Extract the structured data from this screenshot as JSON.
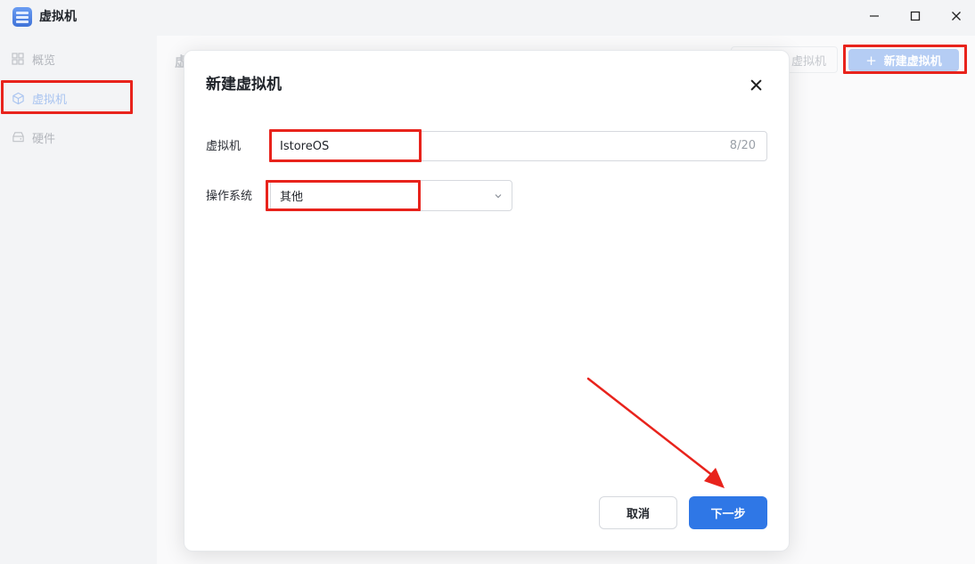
{
  "window": {
    "title": "虚拟机",
    "icons": {
      "app": "server-stack-icon",
      "minimize": "minimize-icon",
      "maximize": "maximize-icon",
      "close": "close-icon"
    }
  },
  "sidebar": {
    "items": [
      {
        "label": "概览",
        "icon": "grid-icon"
      },
      {
        "label": "虚拟机",
        "icon": "cube-icon",
        "active": true
      },
      {
        "label": "硬件",
        "icon": "drive-icon"
      }
    ]
  },
  "main": {
    "page_title": "虚",
    "secondary_button": "虚拟机",
    "new_vm_button": "新建虚拟机",
    "new_vm_icon": "plus-icon"
  },
  "dialog": {
    "title": "新建虚拟机",
    "name_label": "虚拟机",
    "name_value": "IstoreOS",
    "name_counter": "8/20",
    "os_label": "操作系统",
    "os_value": "其他",
    "cancel_label": "取消",
    "next_label": "下一步"
  },
  "colors": {
    "accent": "#2f77e6",
    "highlight": "#e8231c"
  }
}
